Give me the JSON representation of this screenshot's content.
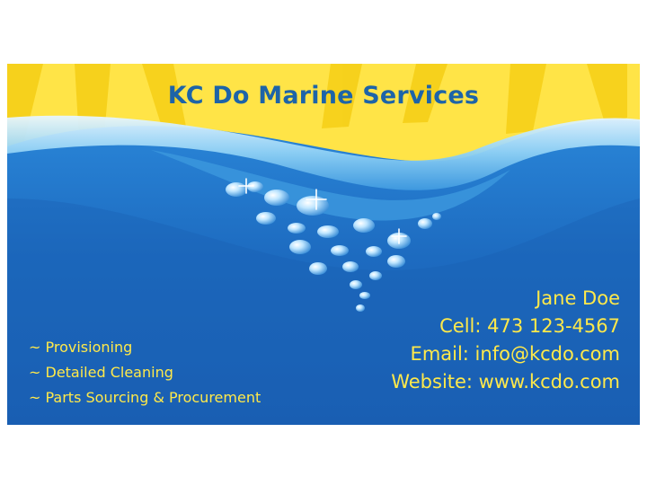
{
  "company": {
    "name": "KC Do Marine Services"
  },
  "services": [
    "~ Provisioning",
    "~ Detailed Cleaning",
    "~ Parts Sourcing & Procurement"
  ],
  "contact": {
    "name": "Jane Doe",
    "cell": "Cell: 473 123-4567",
    "email": "Email: info@kcdo.com",
    "website": "Website: www.kcdo.com"
  },
  "colors": {
    "sky_yellow": "#ffe447",
    "ray_yellow": "#f7d21c",
    "sea_blue": "#1f6fc2",
    "deep_blue": "#1652a3",
    "title_blue": "#1d64a8",
    "text_yellow": "#ffe94a"
  }
}
